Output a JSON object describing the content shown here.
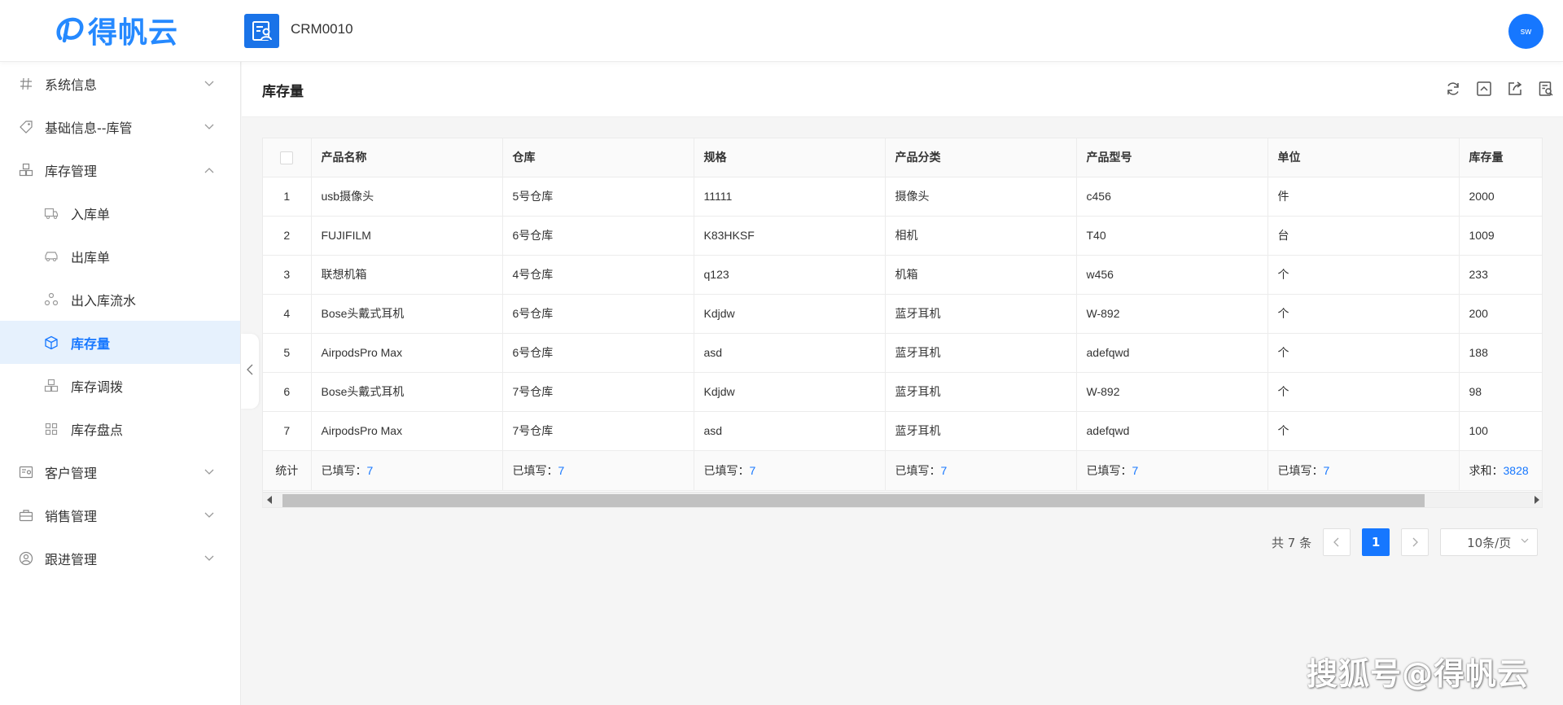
{
  "header": {
    "logo_text": "得帆云",
    "app_name": "CRM0010",
    "avatar_text": "sw"
  },
  "sidebar": {
    "items": [
      {
        "label": "系统信息",
        "icon": "hash-icon",
        "expanded": false
      },
      {
        "label": "基础信息--库管",
        "icon": "tag-icon",
        "expanded": false
      },
      {
        "label": "库存管理",
        "icon": "cubes-icon",
        "expanded": true
      },
      {
        "label": "客户管理",
        "icon": "contact-card-icon",
        "expanded": false
      },
      {
        "label": "销售管理",
        "icon": "briefcase-icon",
        "expanded": false
      },
      {
        "label": "跟进管理",
        "icon": "user-circle-icon",
        "expanded": false
      }
    ],
    "submenu": [
      {
        "label": "入库单",
        "icon": "truck-icon"
      },
      {
        "label": "出库单",
        "icon": "car-icon"
      },
      {
        "label": "出入库流水",
        "icon": "cycle-icon"
      },
      {
        "label": "库存量",
        "icon": "box-icon",
        "active": true
      },
      {
        "label": "库存调拨",
        "icon": "cubes-icon"
      },
      {
        "label": "库存盘点",
        "icon": "grid-icon"
      }
    ]
  },
  "page": {
    "title": "库存量",
    "toolbar_icons": [
      "refresh-icon",
      "collapse-up-icon",
      "share-icon",
      "report-icon"
    ]
  },
  "table": {
    "columns": [
      "产品名称",
      "仓库",
      "规格",
      "产品分类",
      "产品型号",
      "单位",
      "库存量"
    ],
    "rows": [
      [
        "1",
        "usb摄像头",
        "5号仓库",
        "11111",
        "摄像头",
        "c456",
        "件",
        "2000"
      ],
      [
        "2",
        "FUJIFILM",
        "6号仓库",
        "K83HKSF",
        "相机",
        "T40",
        "台",
        "1009"
      ],
      [
        "3",
        "联想机箱",
        "4号仓库",
        "q123",
        "机箱",
        "w456",
        "个",
        "233"
      ],
      [
        "4",
        "Bose头戴式耳机",
        "6号仓库",
        "Kdjdw",
        "蓝牙耳机",
        "W-892",
        "个",
        "200"
      ],
      [
        "5",
        "AirpodsPro Max",
        "6号仓库",
        "asd",
        "蓝牙耳机",
        "adefqwd",
        "个",
        "188"
      ],
      [
        "6",
        "Bose头戴式耳机",
        "7号仓库",
        "Kdjdw",
        "蓝牙耳机",
        "W-892",
        "个",
        "98"
      ],
      [
        "7",
        "AirpodsPro Max",
        "7号仓库",
        "asd",
        "蓝牙耳机",
        "adefqwd",
        "个",
        "100"
      ]
    ],
    "summary": {
      "label": "统计",
      "filled_label": "已填写：",
      "filled_value": "7",
      "sum_label": "求和：",
      "sum_value": "3828"
    }
  },
  "pagination": {
    "total_text": "共 7 条",
    "current_page": "1",
    "page_size": "10条/页"
  },
  "watermark": "搜狐号@得帆云",
  "colors": {
    "accent": "#1677ff",
    "active_bg": "#e6f1fd",
    "logo": "#2589ff"
  }
}
